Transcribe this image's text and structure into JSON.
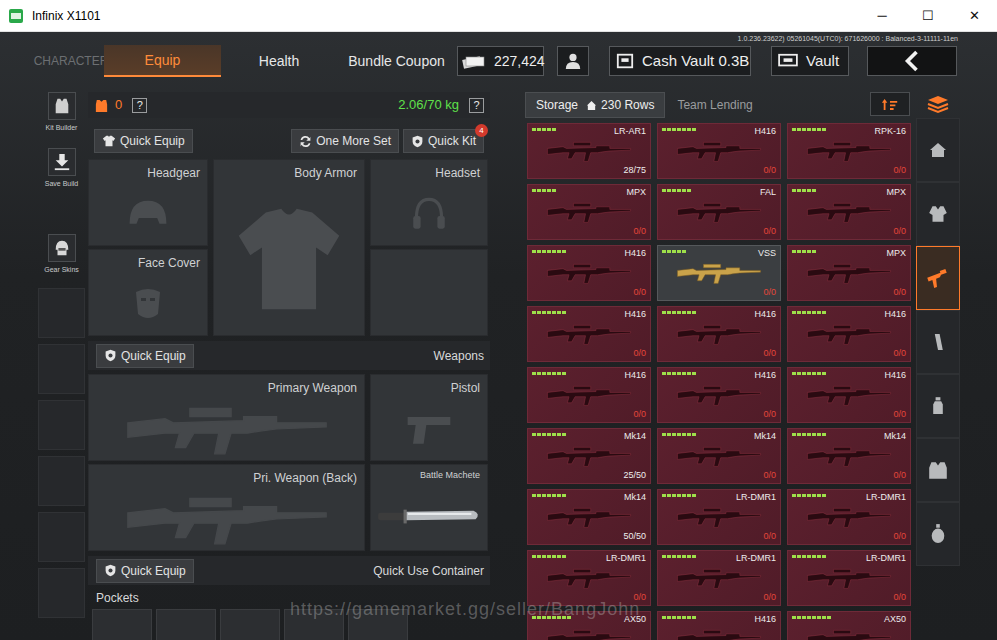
{
  "window": {
    "title": "Infinix X1101",
    "controls": [
      "─",
      "☐",
      "✕"
    ]
  },
  "build_info": "1.0.236.23622) 05261045(UTC0): 671626000 : Balanced-3-11111-11en",
  "top_tabs": [
    {
      "label": "CHARACTER",
      "selected": false,
      "disabled": true
    },
    {
      "label": "Equip",
      "selected": true,
      "disabled": false
    },
    {
      "label": "Health",
      "selected": false,
      "disabled": false
    },
    {
      "label": "Bundle Coupon",
      "selected": false,
      "disabled": false
    }
  ],
  "currency": "227,424",
  "cash_vault": "Cash Vault 0.3B",
  "vault": "Vault",
  "side_tools": [
    {
      "label": "Kit Builder"
    },
    {
      "label": "Save Build"
    },
    {
      "label": "Gear Skins"
    }
  ],
  "equip": {
    "armor_count": "0",
    "help": "?",
    "weight": "2.06/70 kg",
    "weight_help": "?",
    "quick_equip": "Quick Equip",
    "one_more_set": "One More Set",
    "quick_kit": "Quick Kit",
    "quick_kit_badge": "4",
    "gear_slots": [
      {
        "label": "Headgear"
      },
      {
        "label": "Body Armor"
      },
      {
        "label": "Headset"
      },
      {
        "label": "Face Cover"
      }
    ],
    "weapons": {
      "button": "Quick Equip",
      "title": "Weapons",
      "slots": [
        {
          "label": "Primary Weapon",
          "filled": false
        },
        {
          "label": "Pistol",
          "filled": false
        },
        {
          "label": "Pri. Weapon (Back)",
          "filled": false
        },
        {
          "label": "Battle Machete",
          "filled": true
        }
      ]
    },
    "container": {
      "button": "Quick Equip",
      "title": "Quick Use Container"
    },
    "pockets": "Pockets"
  },
  "storage": {
    "tab": "Storage",
    "rows": "230 Rows",
    "team_lending": "Team Lending",
    "items": [
      {
        "name": "LR-AR1",
        "ammo": "28/75",
        "empty": false,
        "stars": 5,
        "kind": "crimson"
      },
      {
        "name": "H416",
        "ammo": "0/0",
        "empty": true,
        "stars": 7,
        "kind": "crimson"
      },
      {
        "name": "RPK-16",
        "ammo": "0/0",
        "empty": true,
        "stars": 7,
        "kind": "crimson"
      },
      {
        "name": "MPX",
        "ammo": "0/0",
        "empty": true,
        "stars": 5,
        "kind": "crimson"
      },
      {
        "name": "FAL",
        "ammo": "0/0",
        "empty": true,
        "stars": 6,
        "kind": "crimson"
      },
      {
        "name": "MPX",
        "ammo": "0/0",
        "empty": true,
        "stars": 5,
        "kind": "crimson"
      },
      {
        "name": "H416",
        "ammo": "0/0",
        "empty": true,
        "stars": 7,
        "kind": "crimson"
      },
      {
        "name": "VSS",
        "ammo": "0/0",
        "empty": true,
        "stars": 5,
        "kind": "gold"
      },
      {
        "name": "MPX",
        "ammo": "0/0",
        "empty": true,
        "stars": 5,
        "kind": "crimson"
      },
      {
        "name": "H416",
        "ammo": "0/0",
        "empty": true,
        "stars": 7,
        "kind": "crimson"
      },
      {
        "name": "H416",
        "ammo": "0/0",
        "empty": true,
        "stars": 7,
        "kind": "crimson"
      },
      {
        "name": "H416",
        "ammo": "0/0",
        "empty": true,
        "stars": 7,
        "kind": "crimson"
      },
      {
        "name": "H416",
        "ammo": "0/0",
        "empty": true,
        "stars": 7,
        "kind": "crimson"
      },
      {
        "name": "H416",
        "ammo": "0/0",
        "empty": true,
        "stars": 7,
        "kind": "crimson"
      },
      {
        "name": "H416",
        "ammo": "0/0",
        "empty": true,
        "stars": 7,
        "kind": "crimson"
      },
      {
        "name": "Mk14",
        "ammo": "25/50",
        "empty": false,
        "stars": 7,
        "kind": "crimson"
      },
      {
        "name": "Mk14",
        "ammo": "0/0",
        "empty": true,
        "stars": 7,
        "kind": "crimson"
      },
      {
        "name": "Mk14",
        "ammo": "0/0",
        "empty": true,
        "stars": 7,
        "kind": "crimson"
      },
      {
        "name": "Mk14",
        "ammo": "50/50",
        "empty": false,
        "stars": 7,
        "kind": "crimson"
      },
      {
        "name": "LR-DMR1",
        "ammo": "0/0",
        "empty": true,
        "stars": 7,
        "kind": "crimson"
      },
      {
        "name": "LR-DMR1",
        "ammo": "0/0",
        "empty": true,
        "stars": 7,
        "kind": "crimson"
      },
      {
        "name": "LR-DMR1",
        "ammo": "0/0",
        "empty": true,
        "stars": 7,
        "kind": "crimson"
      },
      {
        "name": "LR-DMR1",
        "ammo": "0/0",
        "empty": true,
        "stars": 7,
        "kind": "crimson"
      },
      {
        "name": "LR-DMR1",
        "ammo": "0/0",
        "empty": true,
        "stars": 7,
        "kind": "crimson"
      },
      {
        "name": "AX50",
        "stars": 8,
        "kind": "crimson"
      },
      {
        "name": "H416",
        "stars": 7,
        "kind": "crimson"
      },
      {
        "name": "AX50",
        "stars": 8,
        "kind": "crimson"
      }
    ]
  },
  "categories": [
    {
      "selected": false
    },
    {
      "selected": false
    },
    {
      "selected": true
    },
    {
      "selected": false
    },
    {
      "selected": false
    },
    {
      "selected": false
    },
    {
      "selected": false
    }
  ],
  "watermark": "https://gamemarket.gg/seller/BangJohn"
}
